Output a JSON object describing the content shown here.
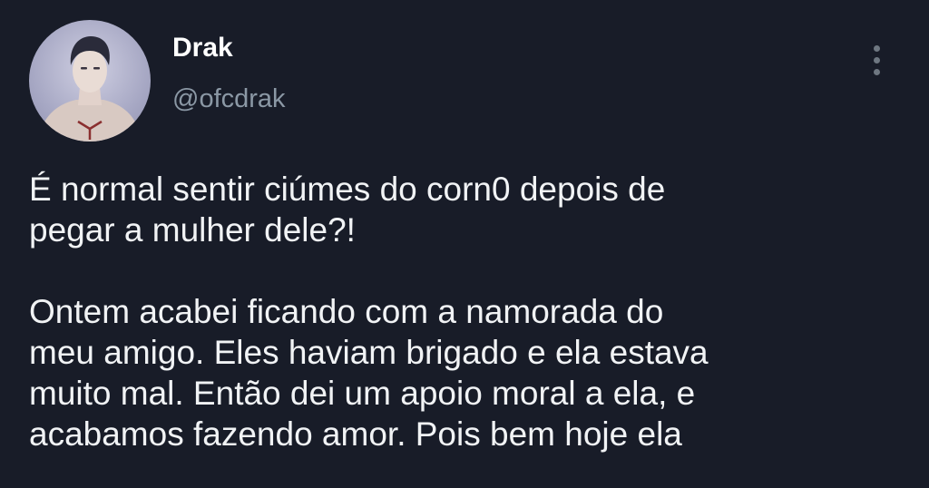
{
  "tweet": {
    "author": {
      "display_name": "Drak",
      "handle": "@ofcdrak",
      "avatar_icon": "profile-avatar"
    },
    "more_icon": "vertical-ellipsis-icon",
    "paragraphs": [
      "É normal sentir ciúmes do corn0 depois de\npegar a mulher dele?!",
      "Ontem acabei ficando com a namorada do\nmeu amigo. Eles haviam brigado e ela estava\nmuito mal. Então dei um apoio moral a ela, e\nacabamos fazendo amor. Pois bem hoje ela"
    ]
  },
  "colors": {
    "background": "#181c28",
    "text": "#f1f3f5",
    "muted": "#8b98a5"
  }
}
